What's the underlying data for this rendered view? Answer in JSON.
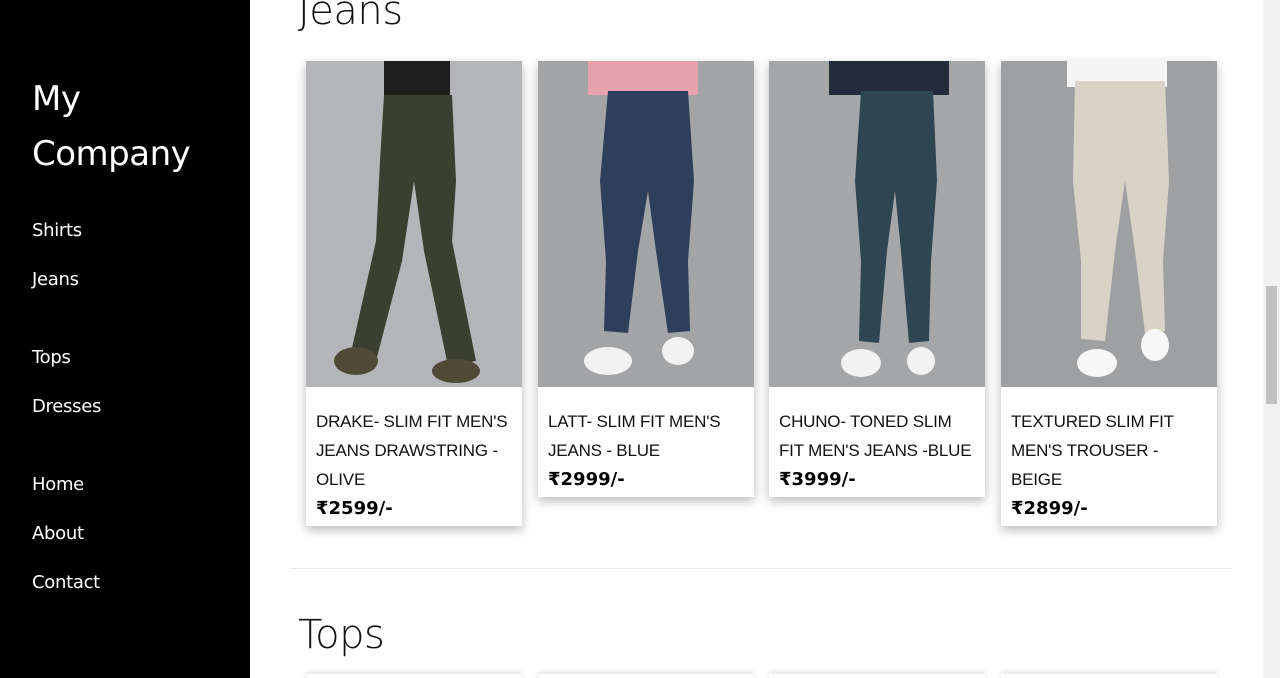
{
  "sidebar": {
    "brand": "My Company",
    "nav": {
      "shirts": "Shirts",
      "jeans": "Jeans",
      "tops": "Tops",
      "dresses": "Dresses",
      "home": "Home",
      "about": "About",
      "contact": "Contact"
    }
  },
  "sections": {
    "jeans_title": "Jeans",
    "tops_title": "Tops"
  },
  "products": [
    {
      "name": "DRAKE- SLIM FIT MEN'S JEANS DRAWSTRING - OLIVE",
      "price": "₹2599/-",
      "color": "#3b4030"
    },
    {
      "name": "LATT- SLIM FIT MEN'S JEANS - BLUE",
      "price": "₹2999/-",
      "color": "#2c3d57"
    },
    {
      "name": "CHUNO- TONED SLIM FIT MEN'S JEANS -BLUE",
      "price": "₹3999/-",
      "color": "#2f4551"
    },
    {
      "name": "TEXTURED SLIM FIT MEN'S TROUSER - BEIGE",
      "price": "₹2899/-",
      "color": "#d9d4c8"
    }
  ],
  "colors": {
    "sidebar_bg": "#000000",
    "sidebar_text": "#ffffff",
    "photo_bg": "#a7a8aa"
  }
}
